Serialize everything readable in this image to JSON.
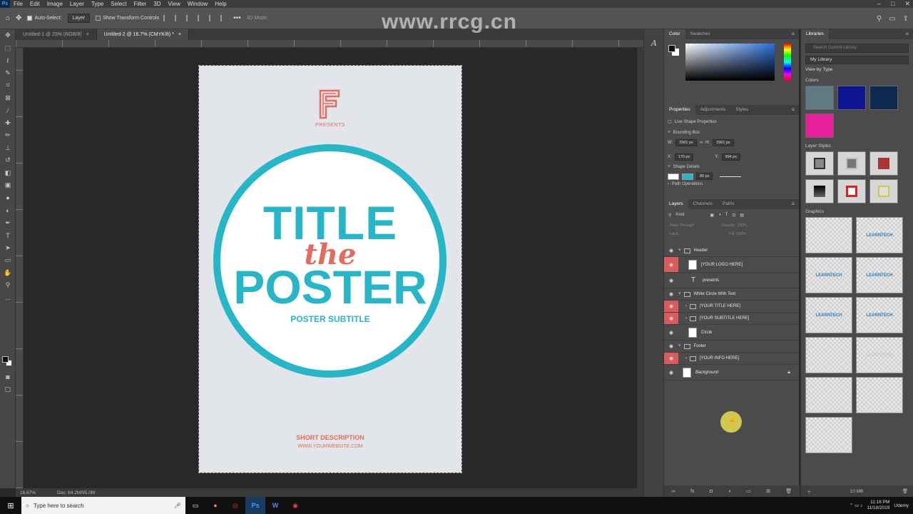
{
  "menu": [
    "File",
    "Edit",
    "Image",
    "Layer",
    "Type",
    "Select",
    "Filter",
    "3D",
    "View",
    "Window",
    "Help"
  ],
  "app_logo": "Ps",
  "options": {
    "auto_select_label": "Auto-Select:",
    "auto_select_value": "Layer",
    "show_transform_label": "Show Transform Controls",
    "mode_label": "3D Mode:"
  },
  "tabs": [
    {
      "label": "Untitled-1 @ 25% (RGB/8)"
    },
    {
      "label": "Untitled-2 @ 16.7% (CMYK/8) *"
    }
  ],
  "watermark": "www.rrcg.cn",
  "poster": {
    "presents": "PRESENTS",
    "title_line1": "TITLE",
    "title_the": "the",
    "title_line2": "POSTER",
    "subtitle": "POSTER SUBTITLE",
    "short_description": "SHORT DESCRIPTION",
    "website": "WWW.YOURWEBSITE.COM",
    "colors": {
      "teal": "#27b6c8",
      "coral": "#e16d5f",
      "paper": "#e2e5ea"
    }
  },
  "status": {
    "zoom": "16.67%",
    "doc": "Doc: 64.2M/95.0M"
  },
  "color_panel": {
    "tabs": [
      "Color",
      "Swatches"
    ]
  },
  "properties": {
    "tabs": [
      "Properties",
      "Adjustments",
      "Styles"
    ],
    "title": "Live Shape Properties",
    "bounding_box": "Bounding Box",
    "w_label": "W:",
    "w": "2961 px",
    "h_label": "H:",
    "h": "2961 px",
    "x_label": "X:",
    "x": "170 px",
    "y_label": "Y:",
    "y": "994 px",
    "shape_details": "Shape Details",
    "stroke_width": "80 px",
    "path_ops": "Path Operations"
  },
  "layers_panel": {
    "tabs": [
      "Layers",
      "Channels",
      "Paths"
    ],
    "filter": "Kind",
    "blend": "Pass Through",
    "opacity": "Opacity: 100%",
    "lock": "Lock:",
    "fill": "Fill: 100%",
    "layers": [
      {
        "name": "Header",
        "type": "group",
        "red": false
      },
      {
        "name": "[YOUR LOGO HERE]",
        "type": "smart",
        "red": true
      },
      {
        "name": "presents",
        "type": "text",
        "red": false
      },
      {
        "name": "White Circle With Text",
        "type": "group",
        "red": false
      },
      {
        "name": "[YOUR TITLE HERE]",
        "type": "subgroup",
        "red": true
      },
      {
        "name": "[YOUR SUBTITLE HERE]",
        "type": "subgroup",
        "red": true
      },
      {
        "name": "Circle",
        "type": "smart",
        "red": false
      },
      {
        "name": "Footer",
        "type": "group",
        "red": false
      },
      {
        "name": "[YOUR INFO HERE]",
        "type": "subgroup",
        "red": true
      },
      {
        "name": "Background",
        "type": "bg",
        "red": false
      }
    ]
  },
  "libraries": {
    "title": "Libraries",
    "search_placeholder": "Search Current Library",
    "library": "My Library",
    "view_by": "View by Type",
    "colors_label": "Colors",
    "swatches": [
      "#627a83",
      "#0f1591",
      "#0d2950",
      "#e81f9a"
    ],
    "layer_styles_label": "Layer Styles",
    "graphics_label": "Graphics",
    "graphic_text": "LEARNTECH",
    "size": "10 MB"
  },
  "taskbar": {
    "search": "Type here to search",
    "apps": [
      "Firefox",
      "Ps",
      "W"
    ],
    "time": "11:16 PM",
    "date": "11/18/2019",
    "user": "Udemy"
  }
}
